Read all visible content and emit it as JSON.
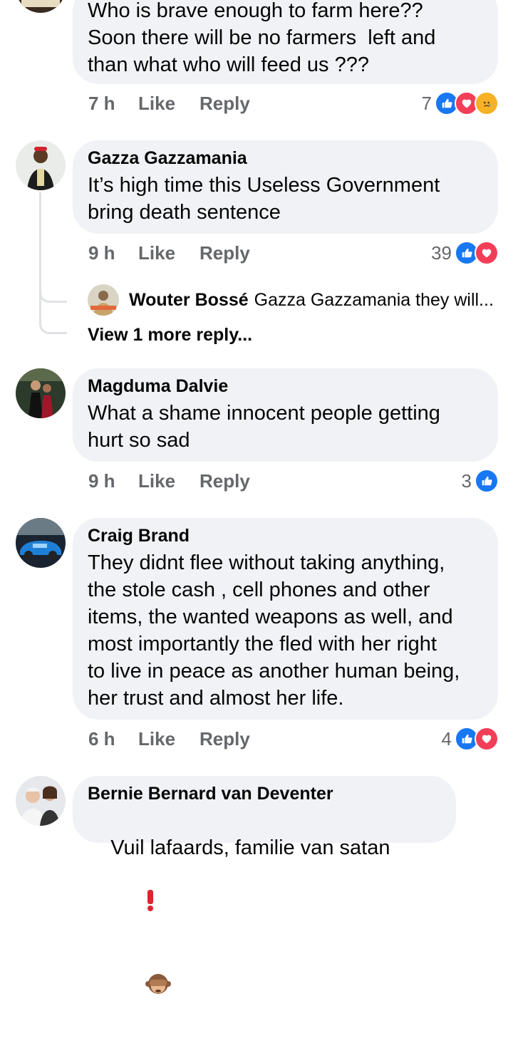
{
  "comments": [
    {
      "author": "",
      "text": "Who is brave enough to farm here??\nSoon there will be no farmers  left and\nthan what who will feed us ???",
      "time": "7 h",
      "like_label": "Like",
      "reply_label": "Reply",
      "reaction_count": "7",
      "reactions": [
        "like",
        "love",
        "sad"
      ]
    },
    {
      "author": "Gazza Gazzamania",
      "text": "It’s high time this Useless Government\nbring death sentence",
      "time": "9 h",
      "like_label": "Like",
      "reply_label": "Reply",
      "reaction_count": "39",
      "reactions": [
        "like",
        "love"
      ],
      "reply_preview": {
        "author": "Wouter Bossé",
        "text": "Gazza Gazzamania they will..."
      },
      "view_more": "View 1 more reply..."
    },
    {
      "author": "Magduma Dalvie",
      "text": "What a shame innocent people getting\nhurt so sad",
      "time": "9 h",
      "like_label": "Like",
      "reply_label": "Reply",
      "reaction_count": "3",
      "reactions": [
        "like"
      ]
    },
    {
      "author": "Craig Brand",
      "text": "They didnt flee without taking anything,\nthe stole cash , cell phones and other\nitems, the wanted weapons as well, and\nmost importantly the fled with her right\nto live in peace as another human being,\nher trust and almost her life.",
      "time": "6 h",
      "like_label": "Like",
      "reply_label": "Reply",
      "reaction_count": "4",
      "reactions": [
        "like",
        "love"
      ]
    },
    {
      "author": "Bernie Bernard van Deventer",
      "text": "Vuil lafaards, familie van satan",
      "emoji": [
        "exclamation-emoji",
        "see-no-evil-monkey-emoji"
      ]
    }
  ],
  "colors": {
    "bubble": "#f0f2f5",
    "meta": "#65676b",
    "like_blue": "#1877f2",
    "love_red": "#f33e58",
    "sad_yellow": "#f7b125",
    "thread_line": "#dfe1e5"
  }
}
